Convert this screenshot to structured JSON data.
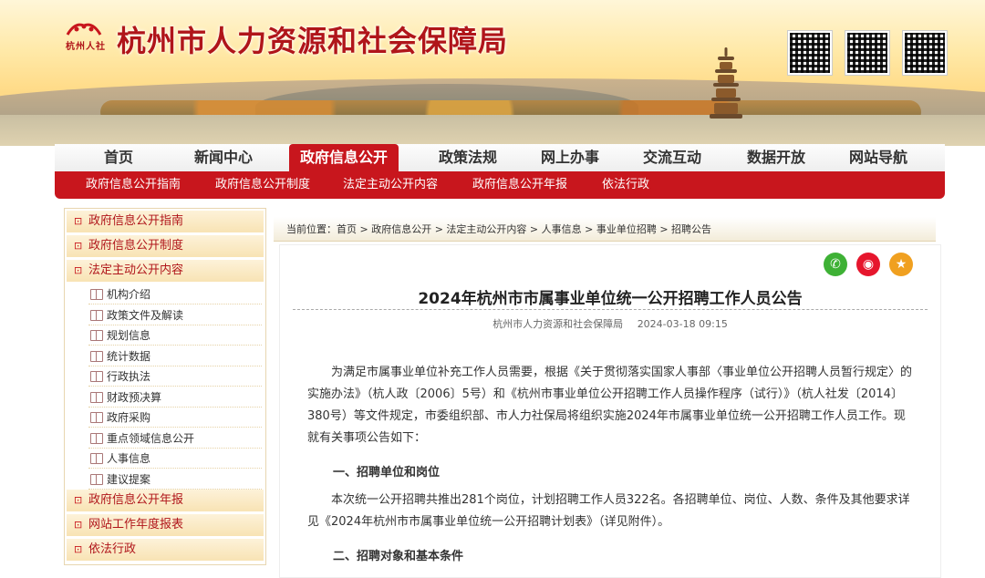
{
  "header": {
    "logo_text": "杭州人社",
    "site_title": "杭州市人力资源和社会保障局"
  },
  "nav": {
    "items": [
      "首页",
      "新闻中心",
      "政府信息公开",
      "政策法规",
      "网上办事",
      "交流互动",
      "数据开放",
      "网站导航"
    ],
    "active_index": 2
  },
  "subnav": {
    "items": [
      "政府信息公开指南",
      "政府信息公开制度",
      "法定主动公开内容",
      "政府信息公开年报",
      "依法行政"
    ]
  },
  "sidebar": {
    "top": [
      "政府信息公开指南",
      "政府信息公开制度",
      "法定主动公开内容"
    ],
    "subs": [
      "机构介绍",
      "政策文件及解读",
      "规划信息",
      "统计数据",
      "行政执法",
      "财政预决算",
      "政府采购",
      "重点领域信息公开",
      "人事信息",
      "建议提案"
    ],
    "bottom": [
      "政府信息公开年报",
      "网站工作年度报表",
      "依法行政"
    ]
  },
  "breadcrumb": {
    "text": "当前位置：首页 > 政府信息公开 > 法定主动公开内容 > 人事信息 > 事业单位招聘 > 招聘公告"
  },
  "article": {
    "title": "2024年杭州市市属事业单位统一公开招聘工作人员公告",
    "source": "杭州市人力资源和社会保障局",
    "date": "2024-03-18 09:15",
    "para1": "为满足市属事业单位补充工作人员需要，根据《关于贯彻落实国家人事部〈事业单位公开招聘人员暂行规定〉的实施办法》（杭人政〔2006〕5号）和《杭州市事业单位公开招聘工作人员操作程序（试行）》（杭人社发〔2014〕380号）等文件规定，市委组织部、市人力社保局将组织实施2024年市属事业单位统一公开招聘工作人员工作。现就有关事项公告如下：",
    "heading1": "一、招聘单位和岗位",
    "para2": "本次统一公开招聘共推出281个岗位，计划招聘工作人员322名。各招聘单位、岗位、人数、条件及其他要求详见《2024年杭州市市属事业单位统一公开招聘计划表》（详见附件）。",
    "heading2": "二、招聘对象和基本条件"
  },
  "share": {
    "icons": [
      "wechat-icon",
      "weibo-icon",
      "favorite-icon"
    ],
    "colors": [
      "#3eb135",
      "#e6162d",
      "#f0a020"
    ]
  }
}
